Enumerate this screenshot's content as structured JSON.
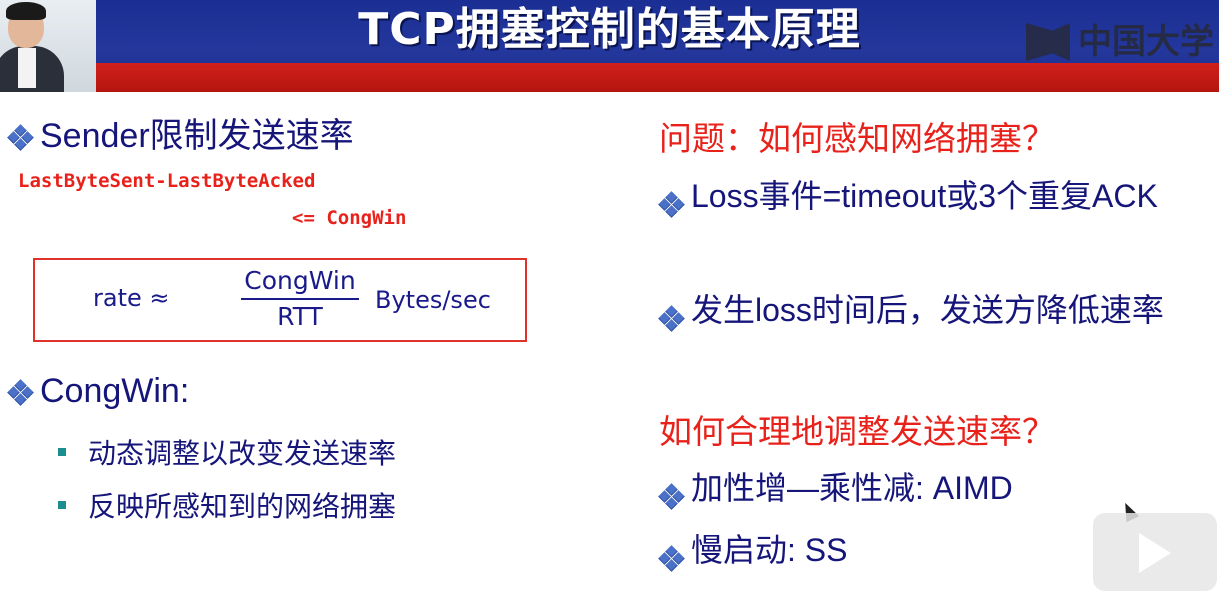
{
  "header": {
    "title": "TCP拥塞控制的基本原理",
    "logo_text": "中国大学"
  },
  "left": {
    "heading1": "Sender限制发送速率",
    "code_line1": "LastByteSent-LastByteAcked",
    "code_line2": "<= CongWin",
    "formula": {
      "lhs": "rate ≈",
      "numerator": "CongWin",
      "denominator": "RTT",
      "unit": "Bytes/sec"
    },
    "heading2": "CongWin:",
    "sub_items": [
      "动态调整以改变发送速率",
      "反映所感知到的网络拥塞"
    ]
  },
  "right": {
    "question1": "问题：如何感知网络拥塞？",
    "items1": [
      "Loss事件=timeout或3个重复ACK",
      "发生loss时间后，发送方降低速率"
    ],
    "question2": "如何合理地调整发送速率？",
    "items2": [
      "加性增—乘性减: AIMD",
      "慢启动: SS"
    ]
  },
  "icons": {
    "bullet": "four-diamond-bullet-icon",
    "sub_bullet": "square-bullet-icon",
    "play": "play-icon",
    "cursor": "mouse-cursor-icon",
    "logo": "mooc-logo-icon"
  },
  "colors": {
    "header_blue": "#24379c",
    "header_red": "#c11a14",
    "body_text": "#15157a",
    "accent_red": "#e8221b"
  }
}
